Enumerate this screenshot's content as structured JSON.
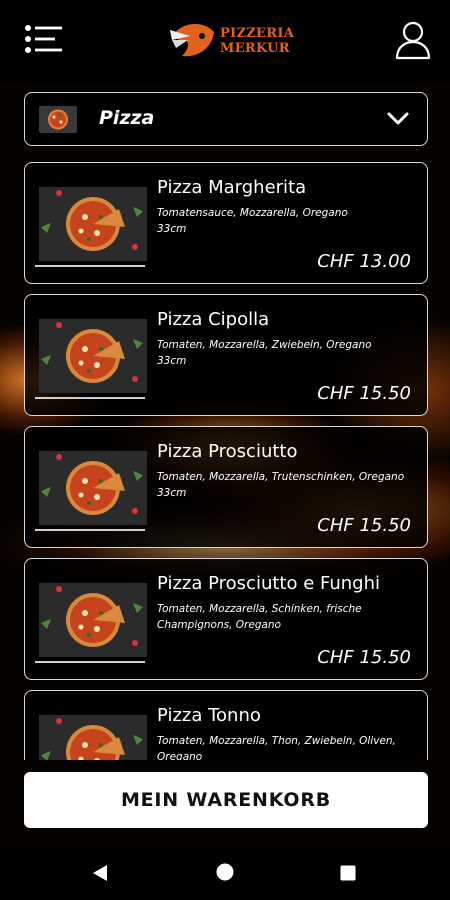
{
  "header": {
    "logo_line1": "PIZZERIA",
    "logo_line2": "MERKUR",
    "menu_icon": "hamburger-menu-icon",
    "user_icon": "user-profile-icon"
  },
  "category": {
    "selected": "Pizza",
    "icon": "chevron-down-icon"
  },
  "products": [
    {
      "name": "Pizza Margherita",
      "description": "Tomatensauce, Mozzarella, Oregano\n33cm",
      "price": "CHF 13.00"
    },
    {
      "name": "Pizza Cipolla",
      "description": "Tomaten, Mozzarella, Zwiebeln, Oregano\n33cm",
      "price": "CHF 15.50"
    },
    {
      "name": "Pizza Prosciutto",
      "description": "Tomaten, Mozzarella, Trutenschinken, Oregano\n33cm",
      "price": "CHF 15.50"
    },
    {
      "name": "Pizza Prosciutto e Funghi",
      "description": "Tomaten, Mozzarella, Schinken, frische Champignons, Oregano",
      "price": "CHF 15.50"
    },
    {
      "name": "Pizza Tonno",
      "description": "Tomaten, Mozzarella, Thon, Zwiebeln, Oliven, Oregano",
      "price": ""
    }
  ],
  "cart_button": "MEIN WARENKORB",
  "navbar": {
    "back_icon": "back-triangle-icon",
    "home_icon": "home-circle-icon",
    "recent_icon": "recent-apps-square-icon"
  },
  "colors": {
    "brand_orange": "#e2611d",
    "card_border": "#d9d9d9",
    "background": "#000000"
  }
}
